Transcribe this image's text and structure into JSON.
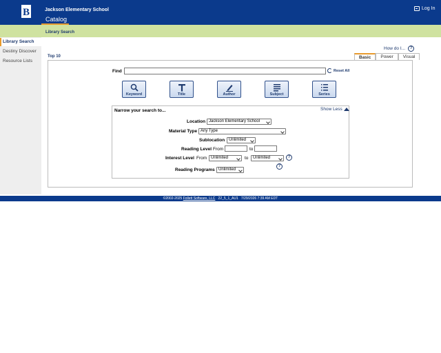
{
  "header": {
    "school_name": "Jackson Elementary School",
    "catalog_tab": "Catalog",
    "login": "Log In",
    "logo_glyph": "B",
    "colors": {
      "brand": "#0b3a8c",
      "accent": "#e89a2c",
      "subbar": "#cfe2a0"
    }
  },
  "subbar": {
    "label": "Library Search"
  },
  "sidebar": {
    "items": [
      {
        "label": "Library Search",
        "active": true
      },
      {
        "label": "Destiny Discover",
        "active": false
      },
      {
        "label": "Resource Lists",
        "active": false
      }
    ]
  },
  "main": {
    "howdo": "How do I...",
    "help_glyph": "?",
    "top10": "Top 10",
    "tabs": [
      "Basic",
      "Power",
      "Visual"
    ],
    "find_label": "Find",
    "find_value": "",
    "reset_all": "Reset All",
    "search_buttons": [
      "Keyword",
      "Title",
      "Author",
      "Subject",
      "Series"
    ]
  },
  "narrow": {
    "title": "Narrow your search to...",
    "show_less": "Show Less",
    "location_label": "Location",
    "location_value": "Jackson Elementary School",
    "material_label": "Material Type",
    "material_value": "Any Type",
    "sublocation_label": "Sublocation",
    "sublocation_value": "Unlimited",
    "reading_level_label": "Reading Level",
    "from": "From",
    "to": "to",
    "interest_label": "Interest Level",
    "interest_from": "Unlimited",
    "interest_to": "Unlimited",
    "reading_programs_label": "Reading Programs",
    "reading_programs_value": "Unlimited"
  },
  "footer": {
    "copyright": "©2002-2025",
    "company": "Follett Software, LLC",
    "version": "22_5_1_AU1",
    "timestamp": "7/29/2026 7:39 AM EDT"
  }
}
